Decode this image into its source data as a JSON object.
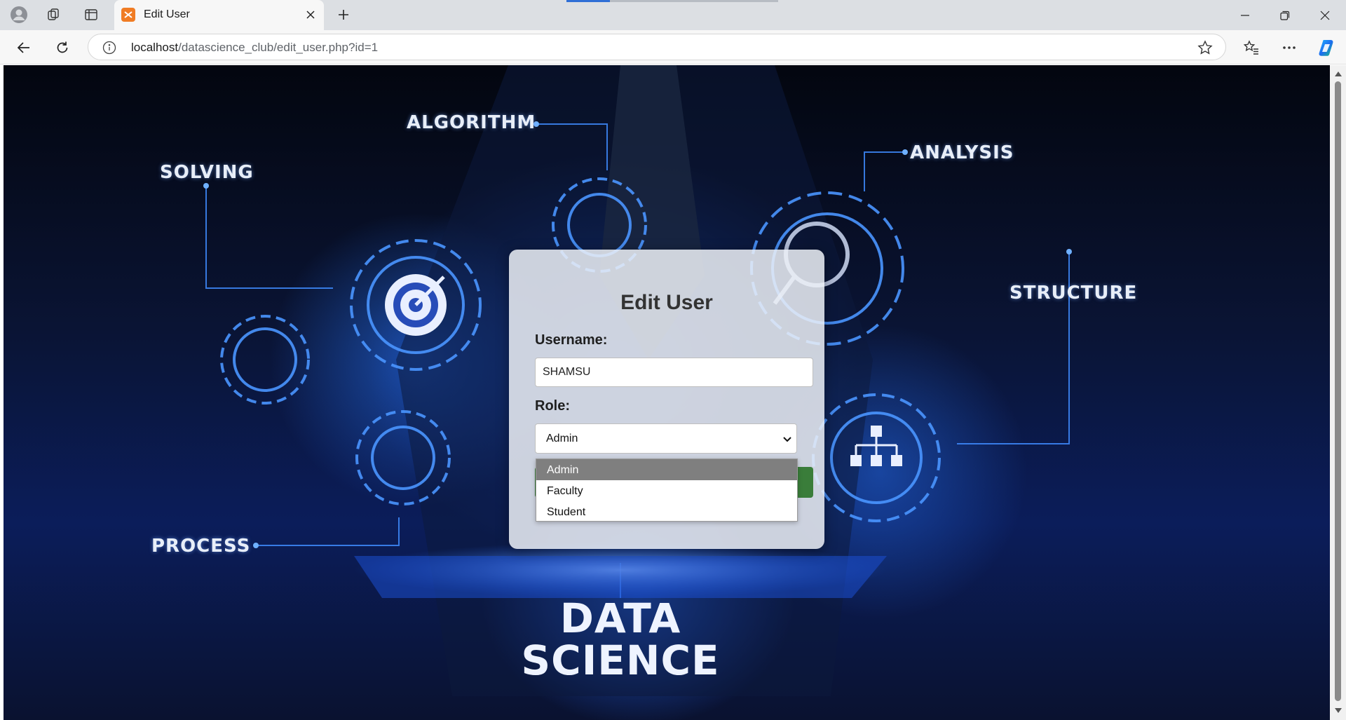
{
  "browser": {
    "tab_title": "Edit User",
    "url_host": "localhost",
    "url_path": "/datascience_club/edit_user.php?id=1"
  },
  "background": {
    "labels": {
      "algorithm": "ALGORITHM",
      "solving": "SOLVING",
      "analysis": "ANALYSIS",
      "structure": "STRUCTURE",
      "process": "PROCESS",
      "data": "DATA",
      "science": "SCIENCE"
    }
  },
  "form": {
    "title": "Edit User",
    "username_label": "Username:",
    "username_value": "SHAMSU",
    "role_label": "Role:",
    "role_selected": "Admin",
    "role_options": [
      "Admin",
      "Faculty",
      "Student"
    ]
  },
  "colors": {
    "favicon": "#f07c24",
    "selected_option": "#7f7f7f",
    "accent_blue": "#1d6cf0"
  }
}
